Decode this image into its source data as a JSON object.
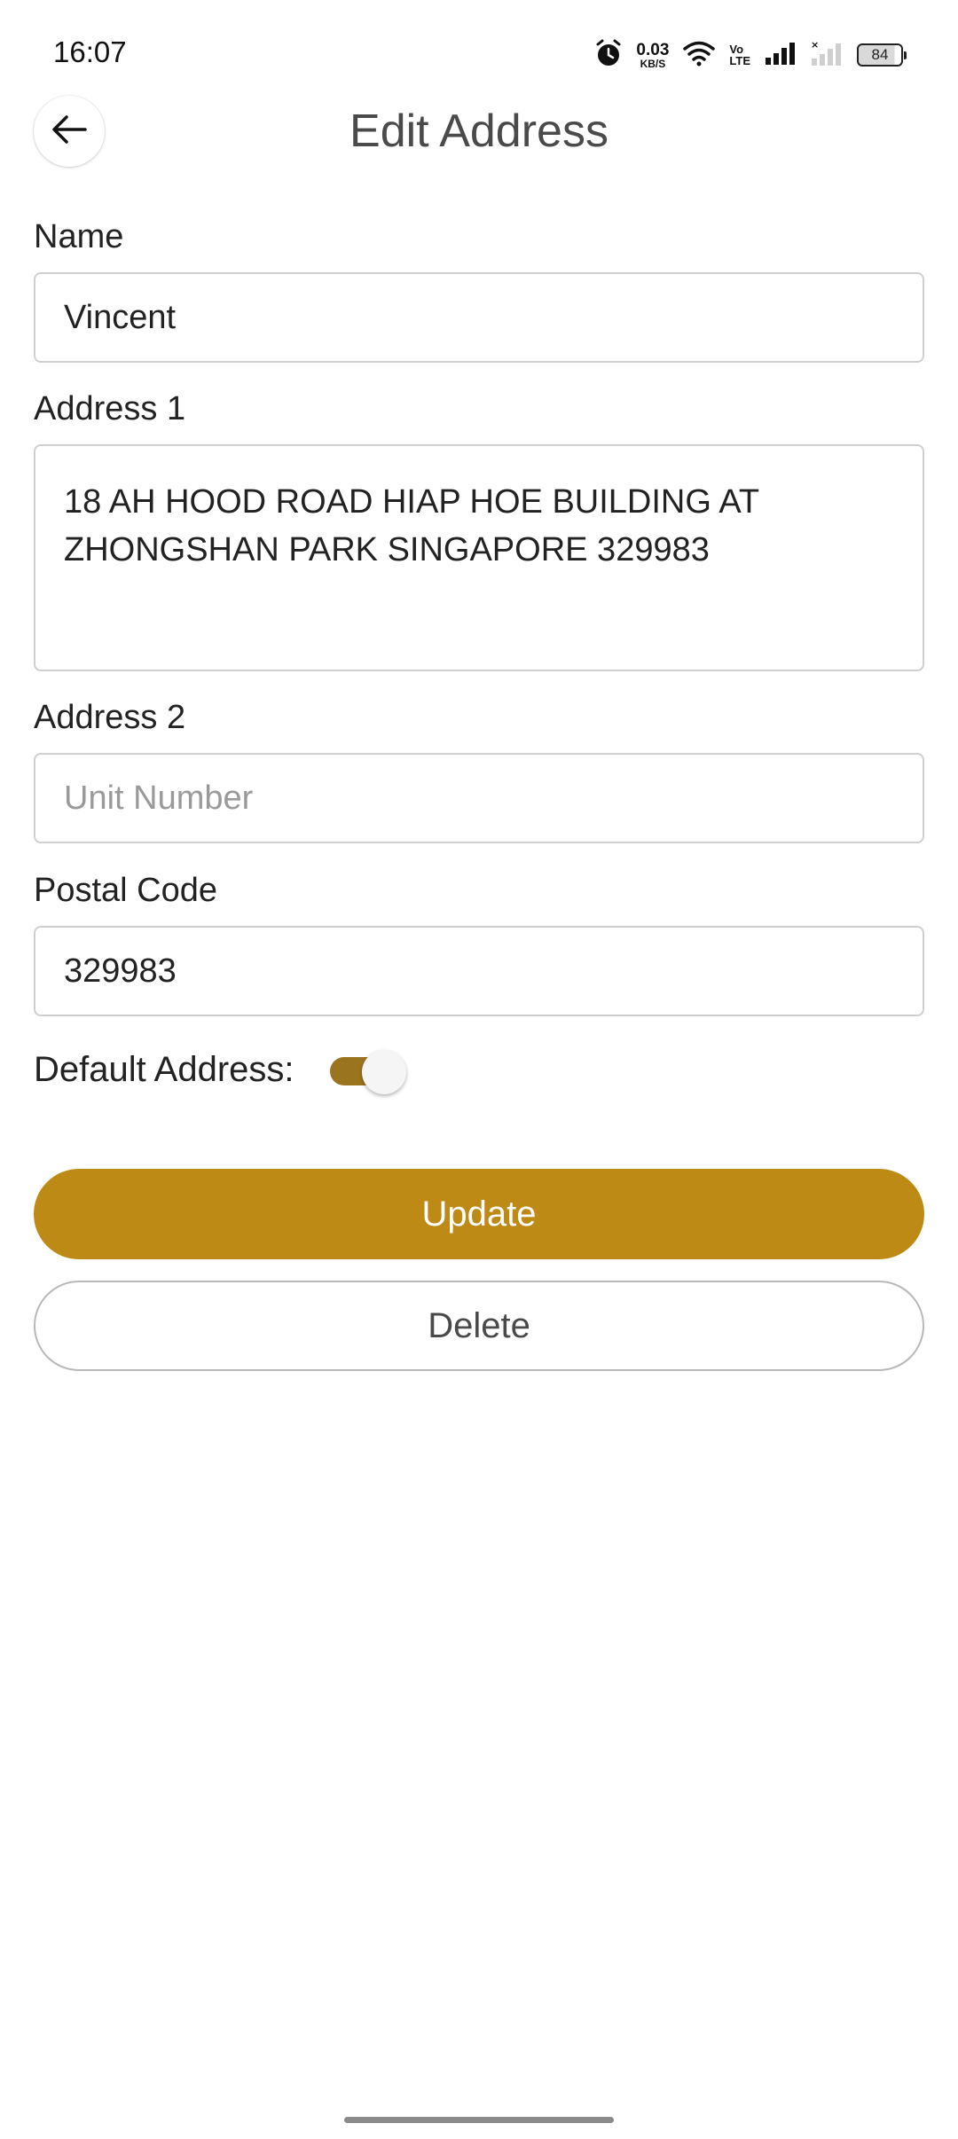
{
  "status_bar": {
    "time": "16:07",
    "net_speed_value": "0.03",
    "net_speed_unit": "KB/S",
    "volte_top": "Vo",
    "volte_bottom": "LTE",
    "battery_level": "84"
  },
  "header": {
    "title": "Edit Address",
    "back_icon": "arrow-left-icon"
  },
  "form": {
    "name": {
      "label": "Name",
      "value": "Vincent"
    },
    "address1": {
      "label": "Address 1",
      "value": "18 AH HOOD ROAD HIAP HOE BUILDING AT ZHONGSHAN PARK SINGAPORE 329983"
    },
    "address2": {
      "label": "Address 2",
      "value": "",
      "placeholder": "Unit Number"
    },
    "postal_code": {
      "label": "Postal Code",
      "value": "329983"
    },
    "default_address": {
      "label": "Default Address:",
      "enabled": true
    }
  },
  "actions": {
    "update_label": "Update",
    "delete_label": "Delete"
  },
  "colors": {
    "accent": "#be8a16",
    "toggle_track": "#9b7420",
    "border": "#cfcfcf"
  }
}
